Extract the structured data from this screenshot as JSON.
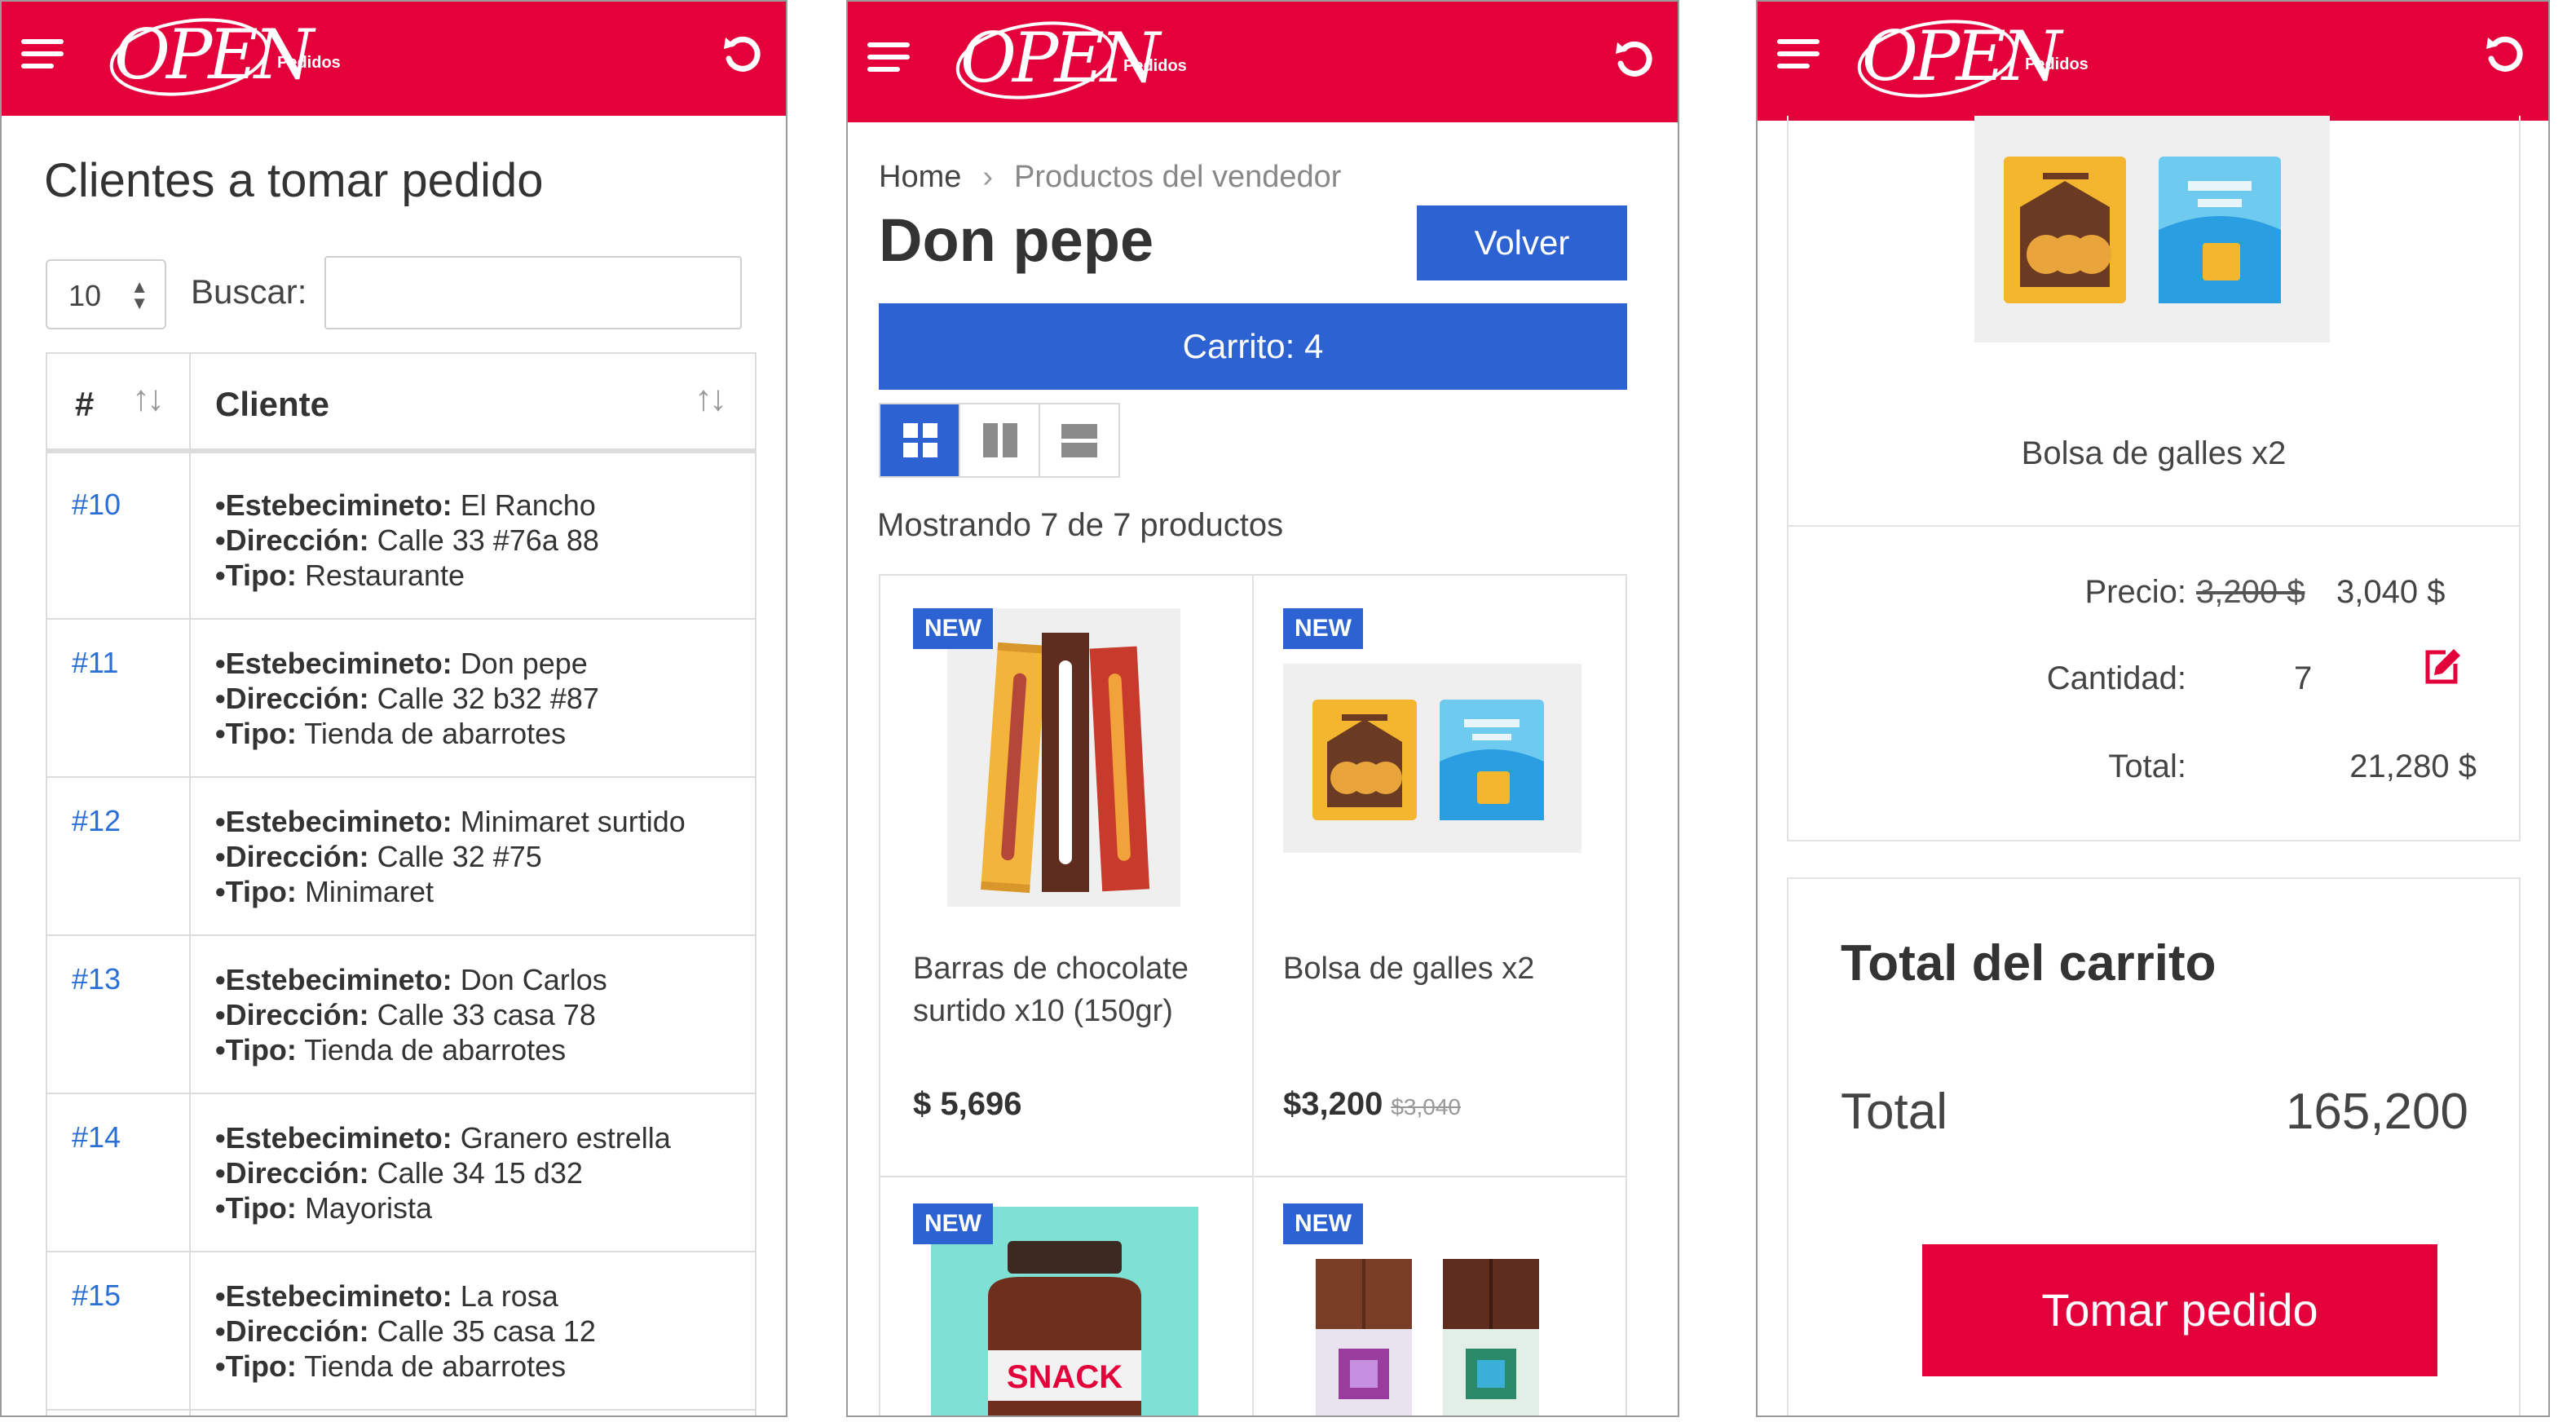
{
  "brand": {
    "logo_text": "OPEN",
    "logo_sub": "Pedidos",
    "color": "#e4003a",
    "accent_blue": "#2c62d1",
    "link_blue": "#2a6fd6"
  },
  "screen1": {
    "title": "Clientes a tomar pedido",
    "length_value": "10",
    "search_label": "Buscar:",
    "search_value": "",
    "columns": [
      "#",
      "Cliente"
    ],
    "rows": [
      {
        "id": "#10",
        "establecimiento": "El Rancho",
        "direccion": "Calle 33 #76a 88",
        "tipo": "Restaurante"
      },
      {
        "id": "#11",
        "establecimiento": "Don pepe",
        "direccion": "Calle 32 b32 #87",
        "tipo": "Tienda de abarrotes"
      },
      {
        "id": "#12",
        "establecimiento": "Minimaret surtido",
        "direccion": "Calle 32 #75",
        "tipo": "Minimaret"
      },
      {
        "id": "#13",
        "establecimiento": "Don Carlos",
        "direccion": "Calle 33 casa 78",
        "tipo": "Tienda de abarrotes"
      },
      {
        "id": "#14",
        "establecimiento": "Granero estrella",
        "direccion": "Calle 34 15 d32",
        "tipo": "Mayorista"
      },
      {
        "id": "#15",
        "establecimiento": "La rosa",
        "direccion": "Calle 35 casa 12",
        "tipo": "Tienda de abarrotes"
      }
    ],
    "labels": {
      "establecimiento": "•Estebecimineto:",
      "direccion": "•Dirección:",
      "tipo": "•Tipo:"
    }
  },
  "screen2": {
    "breadcrumb": {
      "home": "Home",
      "current": "Productos del vendedor"
    },
    "title": "Don pepe",
    "back_button": "Volver",
    "cart_button": "Carrito: 4",
    "showing": "Mostrando 7 de 7 productos",
    "badge": "NEW",
    "products": [
      {
        "name": "Barras de chocolate surtido x10 (150gr)",
        "price": "$ 5,696",
        "old_price": ""
      },
      {
        "name": "Bolsa de galles x2",
        "price": "$3,200",
        "old_price": "$3,040"
      },
      {
        "name": "",
        "price": "",
        "old_price": "",
        "image_text": "SNACK"
      },
      {
        "name": "",
        "price": "",
        "old_price": ""
      }
    ]
  },
  "screen3": {
    "product_name": "Bolsa de galles x2",
    "price_label": "Precio:",
    "price_old": "3,200 $",
    "price_new": "3,040 $",
    "qty_label": "Cantidad:",
    "qty_value": "7",
    "line_total_label": "Total:",
    "line_total_value": "21,280 $",
    "cart_total_title": "Total del carrito",
    "total_label": "Total",
    "total_value": "165,200",
    "submit_button": "Tomar pedido"
  }
}
